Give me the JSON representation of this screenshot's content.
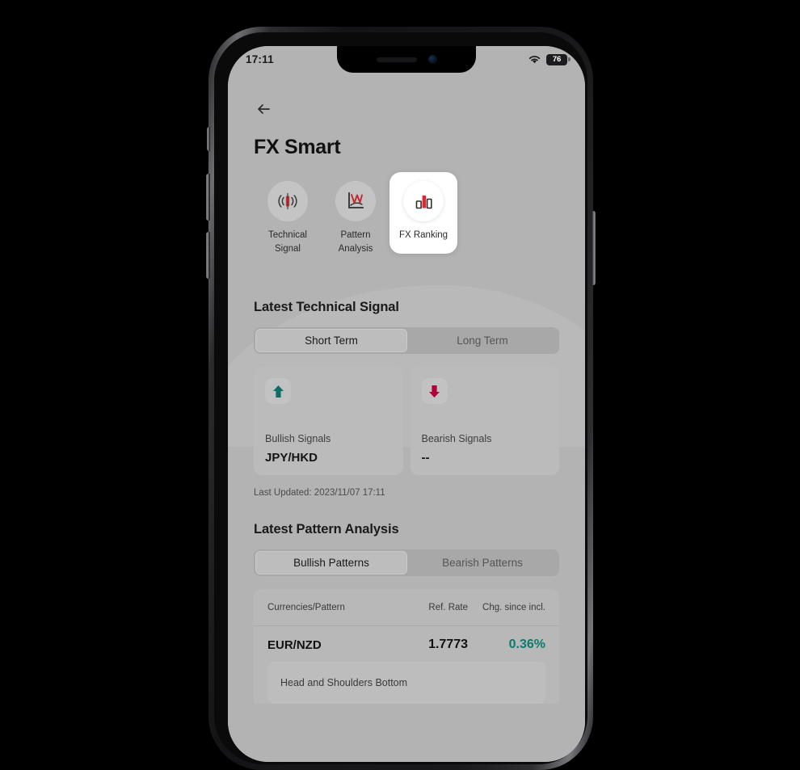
{
  "status_bar": {
    "time": "17:11",
    "wifi_icon": "wifi-icon",
    "battery_level": "76"
  },
  "header": {
    "back_icon": "back-arrow-icon",
    "title": "FX Smart"
  },
  "nav_tiles": [
    {
      "id": "technical-signal",
      "label": "Technical\nSignal",
      "icon": "candlestick-signal-icon",
      "active": false
    },
    {
      "id": "pattern-analysis",
      "label": "Pattern\nAnalysis",
      "icon": "pattern-chart-icon",
      "active": false
    },
    {
      "id": "fx-ranking",
      "label": "FX Ranking",
      "icon": "bar-ranking-icon",
      "active": true
    }
  ],
  "technical_signal": {
    "heading": "Latest Technical Signal",
    "tabs": [
      {
        "label": "Short Term",
        "active": true
      },
      {
        "label": "Long Term",
        "active": false
      }
    ],
    "cards": [
      {
        "name": "Bullish Signals",
        "value": "JPY/HKD",
        "icon": "arrow-up-icon",
        "color": "#0d6e63"
      },
      {
        "name": "Bearish Signals",
        "value": "--",
        "icon": "arrow-down-icon",
        "color": "#b4003a"
      }
    ],
    "last_updated": "Last Updated: 2023/11/07 17:11"
  },
  "pattern_analysis": {
    "heading": "Latest Pattern Analysis",
    "tabs": [
      {
        "label": "Bullish Patterns",
        "active": true
      },
      {
        "label": "Bearish Patterns",
        "active": false
      }
    ],
    "table": {
      "columns": [
        "Currencies/Pattern",
        "Ref. Rate",
        "Chg. since incl."
      ],
      "rows": [
        {
          "pair": "EUR/NZD",
          "ref_rate": "1.7773",
          "change": "0.36%",
          "change_color": "#0d7a70",
          "pattern": "Head and Shoulders Bottom"
        }
      ]
    }
  },
  "theme": {
    "accent_red": "#e3262f",
    "screen_bg": "#b3b3b3",
    "bullish_teal": "#0d7a70",
    "bearish_red": "#b4003a"
  }
}
